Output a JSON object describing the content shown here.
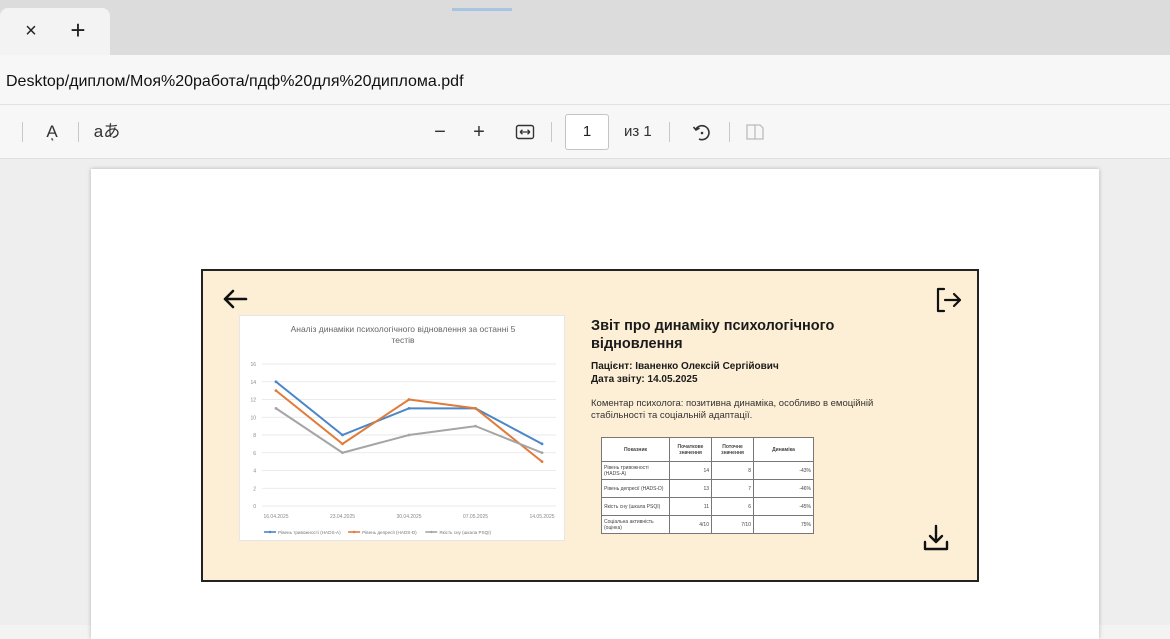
{
  "tabs": {
    "close_icon": "×",
    "new_tab_icon": "+"
  },
  "address": {
    "url": "Desktop/диплом/Моя%20работа/пдф%20для%20диплома.pdf"
  },
  "toolbar": {
    "read_aloud": "Aͅ",
    "text_icon": "aあ",
    "zoom_out": "−",
    "zoom_in": "+",
    "fit_icon": "↔",
    "page_value": "1",
    "page_total": "из 1"
  },
  "slide": {
    "title": "Звіт про динаміку психологічного відновлення",
    "patient": "Пацієнт: Іваненко Олексій Сергійович",
    "date": "Дата звіту: 14.05.2025",
    "comment": "Коментар психолога: позитивна динаміка, особливо в емоційній стабільності та соціальній адаптації.",
    "table": {
      "headers": [
        "Показник",
        "Початкове значення",
        "Поточне значення",
        "Динаміка"
      ],
      "rows": [
        [
          "Рівень тривожності (HADS-A)",
          "14",
          "8",
          "-43%"
        ],
        [
          "Рівень депресії (HADS-D)",
          "13",
          "7",
          "-46%"
        ],
        [
          "Якість сну (шкала PSQI)",
          "11",
          "6",
          "-45%"
        ],
        [
          "Соціальна активність (оцінка)",
          "4/10",
          "7/10",
          "75%"
        ]
      ]
    }
  },
  "chart_data": {
    "type": "line",
    "title": "Аналіз динаміки психологічного відновлення за останні 5 тестів",
    "categories": [
      "16.04.2025",
      "23.04.2025",
      "30.04.2025",
      "07.05.2025",
      "14.05.2025"
    ],
    "ylim": [
      0,
      16
    ],
    "yticks": [
      "0",
      "2",
      "4",
      "6",
      "8",
      "10",
      "12",
      "14",
      "16"
    ],
    "grid": true,
    "legend": "bottom",
    "series": [
      {
        "name": "Рівень тривожності (HADS-A)",
        "values": [
          14,
          8,
          11,
          11,
          7
        ],
        "color": "#4a86c8"
      },
      {
        "name": "Рівень депресії (HADS-D)",
        "values": [
          13,
          7,
          12,
          11,
          5
        ],
        "color": "#e07b39"
      },
      {
        "name": "Якість сну (шкала PSQI)",
        "values": [
          11,
          6,
          8,
          9,
          6
        ],
        "color": "#a5a5a5"
      }
    ]
  }
}
